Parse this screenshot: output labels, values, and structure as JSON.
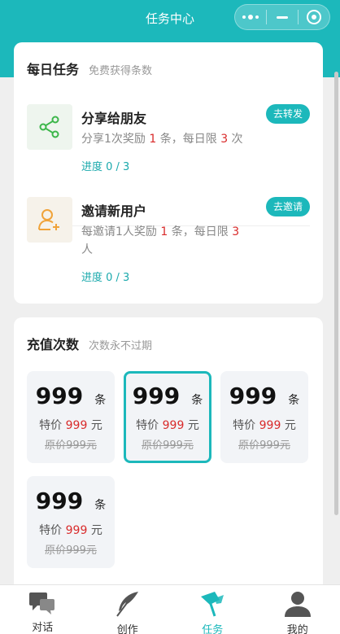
{
  "header": {
    "title": "任务中心"
  },
  "daily": {
    "title": "每日任务",
    "subtitle": "免费获得条数",
    "tasks": [
      {
        "icon": "share-icon",
        "name": "分享给朋友",
        "desc_prefix": "分享1次奖励 ",
        "reward": "1",
        "desc_mid": " 条，每日限 ",
        "limit": "3",
        "desc_suffix": " 次",
        "progress": "进度 0 / 3",
        "button": "去转发"
      },
      {
        "icon": "add-user-icon",
        "name": "邀请新用户",
        "desc_prefix": "每邀请1人奖励 ",
        "reward": "1",
        "desc_mid": " 条，每日限 ",
        "limit": "3",
        "desc_suffix": " 人",
        "progress": "进度 0 / 3",
        "button": "去邀请"
      }
    ]
  },
  "recharge": {
    "title": "充值次数",
    "subtitle": "次数永不过期",
    "packages": [
      {
        "amount": "999",
        "unit": "条",
        "price_label": "特价",
        "price": "999",
        "price_unit": "元",
        "original": "原价999元"
      },
      {
        "amount": "999",
        "unit": "条",
        "price_label": "特价",
        "price": "999",
        "price_unit": "元",
        "original": "原价999元",
        "selected": true
      },
      {
        "amount": "999",
        "unit": "条",
        "price_label": "特价",
        "price": "999",
        "price_unit": "元",
        "original": "原价999元"
      },
      {
        "amount": "999",
        "unit": "条",
        "price_label": "特价",
        "price": "999",
        "price_unit": "元",
        "original": "原价999元"
      }
    ]
  },
  "tabbar": {
    "items": [
      {
        "label": "对话",
        "icon": "chat-icon"
      },
      {
        "label": "创作",
        "icon": "feather-icon"
      },
      {
        "label": "任务",
        "icon": "flag-icon",
        "active": true
      },
      {
        "label": "我的",
        "icon": "user-icon"
      }
    ]
  },
  "colors": {
    "accent": "#1cb8bb",
    "highlight": "#d92b2b"
  }
}
